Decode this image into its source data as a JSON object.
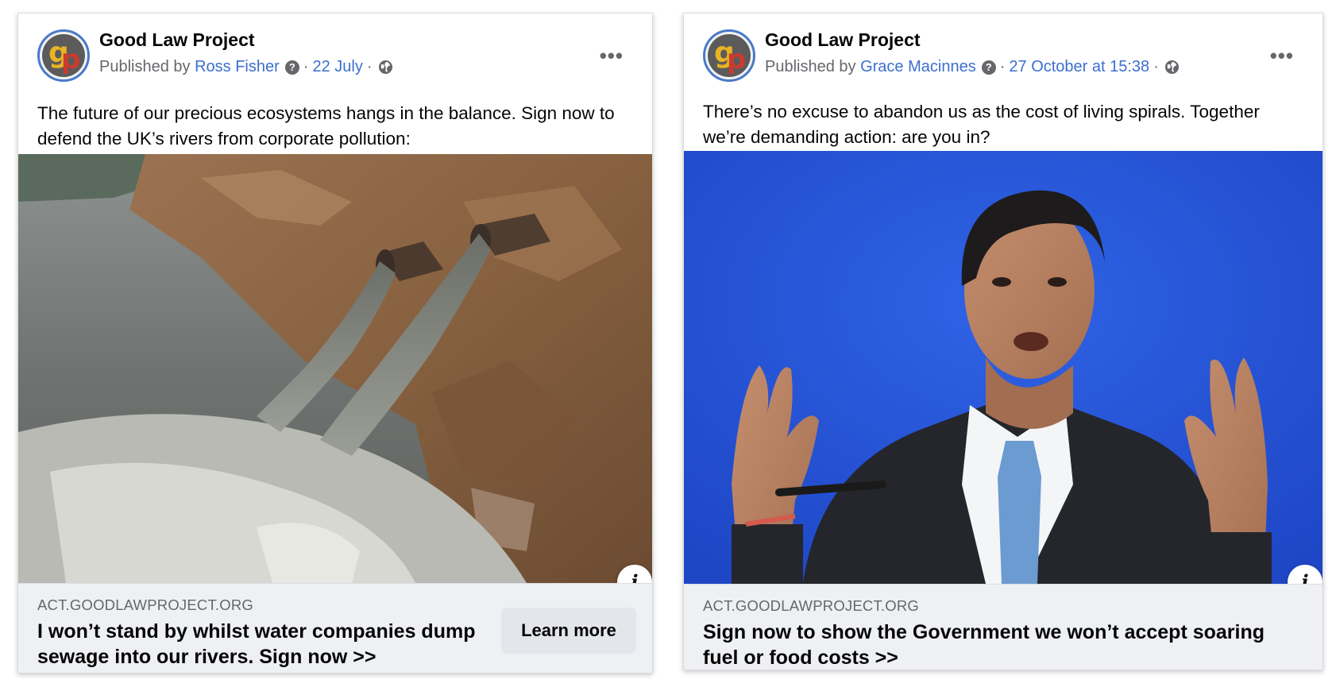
{
  "posts": [
    {
      "page_name": "Good Law Project",
      "published_by_label": "Published by",
      "author": "Ross Fisher",
      "date": "22 July",
      "body": "The future of our precious ecosystems hangs in the balance. Sign now to defend the UK’s rivers from corporate pollution:",
      "link": {
        "domain": "ACT.GOODLAWPROJECT.ORG",
        "headline": "I won’t stand by whilst water companies dump sewage into our rivers. Sign now >>",
        "cta": "Learn more"
      },
      "icons": [
        "avatar",
        "question-icon",
        "globe-icon",
        "more-icon",
        "info-icon"
      ]
    },
    {
      "page_name": "Good Law Project",
      "published_by_label": "Published by",
      "author": "Grace Macinnes",
      "date": "27 October at 15:38",
      "body": "There’s no excuse to abandon us as the cost of living spirals. Together we’re demanding action: are you in?",
      "link": {
        "domain": "ACT.GOODLAWPROJECT.ORG",
        "headline": "Sign now to show the Government we won’t accept soaring fuel or food costs >>"
      },
      "icons": [
        "avatar",
        "question-icon",
        "globe-icon",
        "more-icon",
        "info-icon"
      ]
    }
  ],
  "colors": {
    "link_blue": "#3d6fd0",
    "meta_gray": "#65676b",
    "link_bar_bg": "#eef0f3",
    "button_bg": "#e4e6eb",
    "photo2_background": "#2a56d8"
  }
}
